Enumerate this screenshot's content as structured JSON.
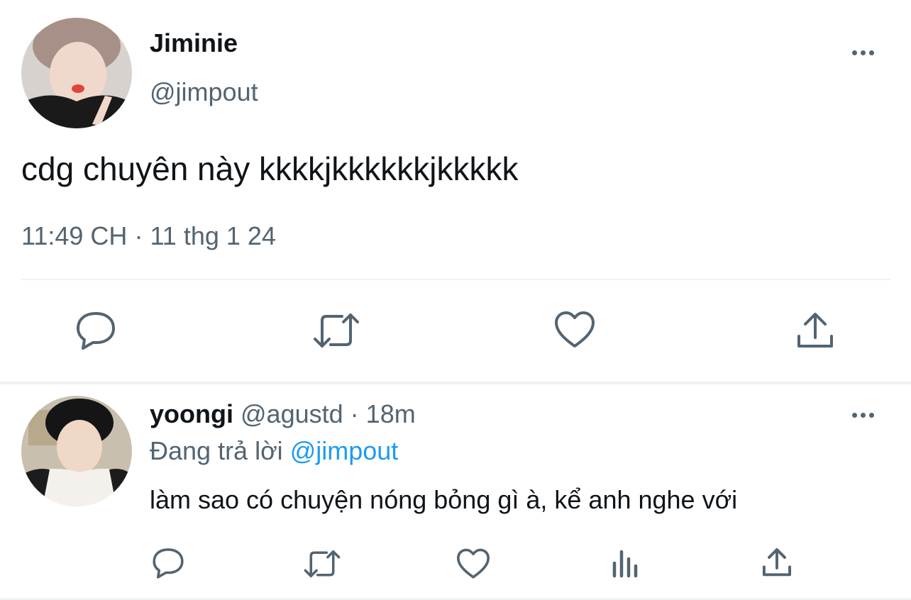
{
  "main_tweet": {
    "author_name": "Jiminie",
    "author_handle": "@jimpout",
    "text": "cdg chuyên này kkkkjkkkkkkjkkkkk",
    "time": "11:49 CH",
    "separator": "·",
    "date": "11 thg 1 24",
    "actions": [
      "reply-icon",
      "retweet-icon",
      "like-icon",
      "share-icon"
    ]
  },
  "reply_tweet": {
    "author_name": "yoongi",
    "author_handle": "@agustd",
    "separator": "·",
    "age": "18m",
    "replying_prefix": "Đang trả lời",
    "replying_to": "@jimpout",
    "text": "làm sao có chuyện nóng bỏng gì à, kể anh nghe với",
    "actions": [
      "reply-icon",
      "retweet-icon",
      "like-icon",
      "analytics-icon",
      "share-icon"
    ]
  },
  "colors": {
    "text": "#0f1419",
    "muted": "#536471",
    "link": "#1d9bf0",
    "divider": "#eff3f4"
  }
}
